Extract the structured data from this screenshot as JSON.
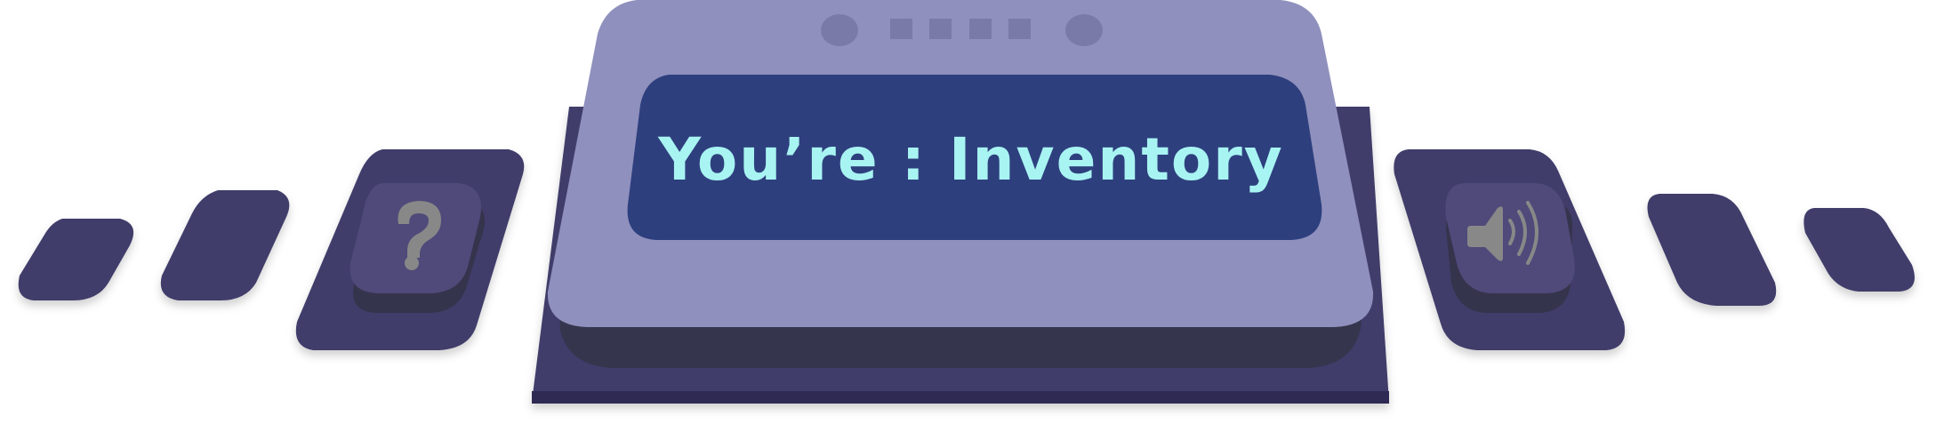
{
  "header": {
    "title": "You’re : Inventory"
  },
  "buttons": {
    "help": {
      "icon": "question-mark-icon"
    },
    "sound": {
      "icon": "speaker-sound-on-icon"
    }
  },
  "colors": {
    "panel_light": "#8f90bd",
    "panel_dark": "#403d6b",
    "panel_shadow": "#35344d",
    "title_panel": "#2e3f7e",
    "title_text": "#a8f4f2",
    "icon_gray": "#888888",
    "button_face": "#4f4a7a"
  }
}
